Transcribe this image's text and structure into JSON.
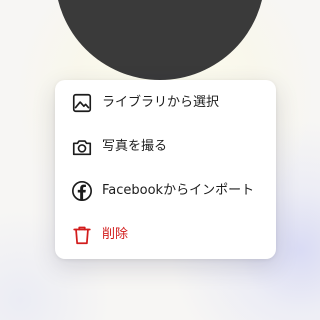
{
  "colors": {
    "avatar": "#3a3a3a",
    "menu_background": "#ffffff",
    "text": "#1c1c1c",
    "danger": "#d21c1c"
  },
  "menu": {
    "items": [
      {
        "label": "ライブラリから選択",
        "icon": "image-icon"
      },
      {
        "label": "写真を撮る",
        "icon": "camera-icon"
      },
      {
        "label": "Facebookからインポート",
        "icon": "facebook-icon"
      },
      {
        "label": "削除",
        "icon": "trash-icon",
        "danger": true
      }
    ]
  }
}
